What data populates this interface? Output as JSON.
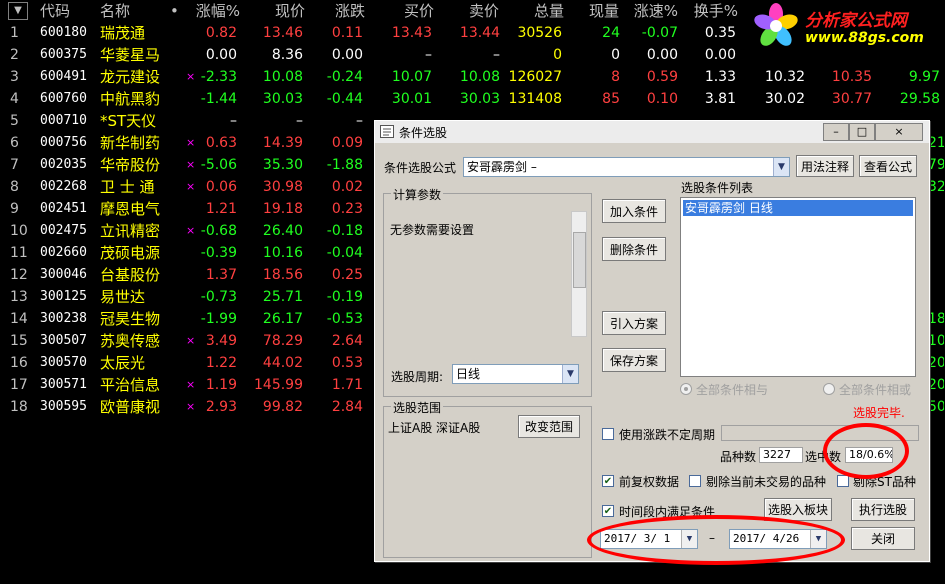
{
  "headers": {
    "menu": "▼",
    "code": "代码",
    "name": "名称",
    "dot": "•",
    "pct": "涨幅%",
    "price": "现价",
    "chg": "涨跌",
    "bid": "买价",
    "ask": "卖价",
    "vol": "总量",
    "cur": "现量",
    "speed": "涨速%",
    "turnover": "换手%"
  },
  "rows": [
    {
      "i": "1",
      "code": "600180",
      "name": "瑞茂通",
      "mark": "",
      "pct": "0.82",
      "price": "13.46",
      "chg": "0.11",
      "bid": "13.43",
      "ask": "13.44",
      "vol": "30526",
      "cur": "24",
      "speed": "-0.07",
      "turn": "0.35",
      "e1": "",
      "e2": "",
      "e3": "",
      "c": "up",
      "cc": "down"
    },
    {
      "i": "2",
      "code": "600375",
      "name": "华菱星马",
      "mark": "",
      "pct": "0.00",
      "price": "8.36",
      "chg": "0.00",
      "bid": "–",
      "ask": "–",
      "vol": "0",
      "cur": "0",
      "speed": "0.00",
      "turn": "0.00",
      "e1": "",
      "e2": "",
      "e3": "",
      "c": "flat",
      "cc": "flat"
    },
    {
      "i": "3",
      "code": "600491",
      "name": "龙元建设",
      "mark": "×",
      "pct": "-2.33",
      "price": "10.08",
      "chg": "-0.24",
      "bid": "10.07",
      "ask": "10.08",
      "vol": "126027",
      "cur": "8",
      "speed": "0.59",
      "turn": "1.33",
      "e1": "10.32",
      "e2": "10.35",
      "e3": "9.97",
      "c": "down",
      "cc": "up"
    },
    {
      "i": "4",
      "code": "600760",
      "name": "中航黑豹",
      "mark": "",
      "pct": "-1.44",
      "price": "30.03",
      "chg": "-0.44",
      "bid": "30.01",
      "ask": "30.03",
      "vol": "131408",
      "cur": "85",
      "speed": "0.10",
      "turn": "3.81",
      "e1": "30.02",
      "e2": "30.77",
      "e3": "29.58",
      "c": "down",
      "cc": "up"
    },
    {
      "i": "5",
      "code": "000710",
      "name": "*ST天仪",
      "mark": "",
      "pct": "–",
      "price": "–",
      "chg": "–",
      "bid": "",
      "ask": "",
      "vol": "",
      "cur": "",
      "speed": "",
      "turn": "",
      "e1": "",
      "e2": "",
      "e3": "",
      "c": "flat",
      "cc": "flat"
    },
    {
      "i": "6",
      "code": "000756",
      "name": "新华制药",
      "mark": "×",
      "pct": "0.63",
      "price": "14.39",
      "chg": "0.09",
      "bid": "",
      "ask": "",
      "vol": "",
      "cur": "",
      "speed": "",
      "turn": "",
      "e1": "",
      "e2": "",
      "e3": "",
      "c": "up",
      "cc": "up"
    },
    {
      "i": "7",
      "code": "002035",
      "name": "华帝股份",
      "mark": "×",
      "pct": "-5.06",
      "price": "35.30",
      "chg": "-1.88",
      "bid": "",
      "ask": "",
      "vol": "",
      "cur": "",
      "speed": "",
      "turn": "",
      "e1": "",
      "e2": "",
      "e3": "",
      "c": "down",
      "cc": "up"
    },
    {
      "i": "8",
      "code": "002268",
      "name": "卫 士 通",
      "mark": "×",
      "pct": "0.06",
      "price": "30.98",
      "chg": "0.02",
      "bid": "",
      "ask": "",
      "vol": "",
      "cur": "",
      "speed": "",
      "turn": "",
      "e1": "",
      "e2": "",
      "e3": "",
      "c": "up",
      "cc": "up"
    },
    {
      "i": "9",
      "code": "002451",
      "name": "摩恩电气",
      "mark": "",
      "pct": "1.21",
      "price": "19.18",
      "chg": "0.23",
      "bid": "",
      "ask": "",
      "vol": "",
      "cur": "",
      "speed": "",
      "turn": "",
      "e1": "",
      "e2": "",
      "e3": "",
      "c": "up",
      "cc": "up"
    },
    {
      "i": "10",
      "code": "002475",
      "name": "立讯精密",
      "mark": "×",
      "pct": "-0.68",
      "price": "26.40",
      "chg": "-0.18",
      "bid": "",
      "ask": "",
      "vol": "",
      "cur": "",
      "speed": "",
      "turn": "",
      "e1": "",
      "e2": "",
      "e3": "",
      "c": "down",
      "cc": "up"
    },
    {
      "i": "11",
      "code": "002660",
      "name": "茂硕电源",
      "mark": "",
      "pct": "-0.39",
      "price": "10.16",
      "chg": "-0.04",
      "bid": "",
      "ask": "",
      "vol": "",
      "cur": "",
      "speed": "",
      "turn": "",
      "e1": "",
      "e2": "",
      "e3": "",
      "c": "down",
      "cc": "up"
    },
    {
      "i": "12",
      "code": "300046",
      "name": "台基股份",
      "mark": "",
      "pct": "1.37",
      "price": "18.56",
      "chg": "0.25",
      "bid": "",
      "ask": "",
      "vol": "",
      "cur": "",
      "speed": "",
      "turn": "",
      "e1": "",
      "e2": "",
      "e3": "",
      "c": "up",
      "cc": "up"
    },
    {
      "i": "13",
      "code": "300125",
      "name": "易世达",
      "mark": "",
      "pct": "-0.73",
      "price": "25.71",
      "chg": "-0.19",
      "bid": "",
      "ask": "",
      "vol": "",
      "cur": "",
      "speed": "",
      "turn": "",
      "e1": "",
      "e2": "",
      "e3": "",
      "c": "down",
      "cc": "up"
    },
    {
      "i": "14",
      "code": "300238",
      "name": "冠昊生物",
      "mark": "",
      "pct": "-1.99",
      "price": "26.17",
      "chg": "-0.53",
      "bid": "",
      "ask": "",
      "vol": "",
      "cur": "",
      "speed": "",
      "turn": "",
      "e1": "",
      "e2": "",
      "e3": "",
      "c": "down",
      "cc": "up"
    },
    {
      "i": "15",
      "code": "300507",
      "name": "苏奥传感",
      "mark": "×",
      "pct": "3.49",
      "price": "78.29",
      "chg": "2.64",
      "bid": "",
      "ask": "",
      "vol": "",
      "cur": "",
      "speed": "",
      "turn": "",
      "e1": "",
      "e2": "",
      "e3": "",
      "c": "up",
      "cc": "up"
    },
    {
      "i": "16",
      "code": "300570",
      "name": "太辰光",
      "mark": "",
      "pct": "1.22",
      "price": "44.02",
      "chg": "0.53",
      "bid": "",
      "ask": "",
      "vol": "",
      "cur": "",
      "speed": "",
      "turn": "",
      "e1": "",
      "e2": "",
      "e3": "",
      "c": "up",
      "cc": "up"
    },
    {
      "i": "17",
      "code": "300571",
      "name": "平治信息",
      "mark": "×",
      "pct": "1.19",
      "price": "145.99",
      "chg": "1.71",
      "bid": "",
      "ask": "",
      "vol": "",
      "cur": "",
      "speed": "",
      "turn": "",
      "e1": "",
      "e2": "",
      "e3": "",
      "c": "up",
      "cc": "up"
    },
    {
      "i": "18",
      "code": "300595",
      "name": "欧普康视",
      "mark": "×",
      "pct": "2.93",
      "price": "99.82",
      "chg": "2.84",
      "bid": "",
      "ask": "",
      "vol": "",
      "cur": "",
      "speed": "",
      "turn": "",
      "e1": "",
      "e2": "",
      "e3": "",
      "c": "up",
      "cc": "up"
    }
  ],
  "edge_right": [
    "21",
    "79",
    "32",
    "",
    "",
    "",
    "",
    "",
    "18",
    "10",
    "20",
    "20",
    "50"
  ],
  "logo": {
    "line1": "分析家公式网",
    "line2": "www.88gs.com"
  },
  "dialog": {
    "title": "条件选股",
    "formula_label": "条件选股公式",
    "formula_value": "安哥霹雳剑   –",
    "usage_button": "用法注释",
    "view_formula_button": "查看公式",
    "params_group": "计算参数",
    "params_text": "无参数需要设置",
    "period_label": "选股周期:",
    "period_value": "日线",
    "add_button": "加入条件",
    "delete_button": "删除条件",
    "import_button": "引入方案",
    "save_button": "保存方案",
    "list_label": "选股条件列表",
    "list_items": [
      "安哥霹雳剑  日线"
    ],
    "radio_and": "全部条件相与",
    "radio_or": "全部条件相或",
    "done_text": "选股完毕.",
    "scope_group": "选股范围",
    "scope_text": "上证A股 深证A股",
    "change_scope_button": "改变范围",
    "variable_period_label": "使用涨跌不定周期",
    "count_label": "品种数",
    "count_value": "3227",
    "selected_label": "选中数",
    "selected_value": "18/0.6%",
    "prerights_label": "前复权数据",
    "exclude_untraded_label": "剔除当前未交易的品种",
    "exclude_st_label": "剔除ST品种",
    "time_range_label": "时间段内满足条件",
    "to_block_button": "选股入板块",
    "execute_button": "执行选股",
    "date_from": "2017/ 3/ 1",
    "date_dash": "–",
    "date_to": "2017/ 4/26",
    "close_button": "关闭",
    "win_min": "–",
    "win_max": "□",
    "win_close": "×"
  },
  "colors": {
    "up": "#ff4040",
    "down": "#20ff20",
    "accent_ring": "#ff0000"
  }
}
